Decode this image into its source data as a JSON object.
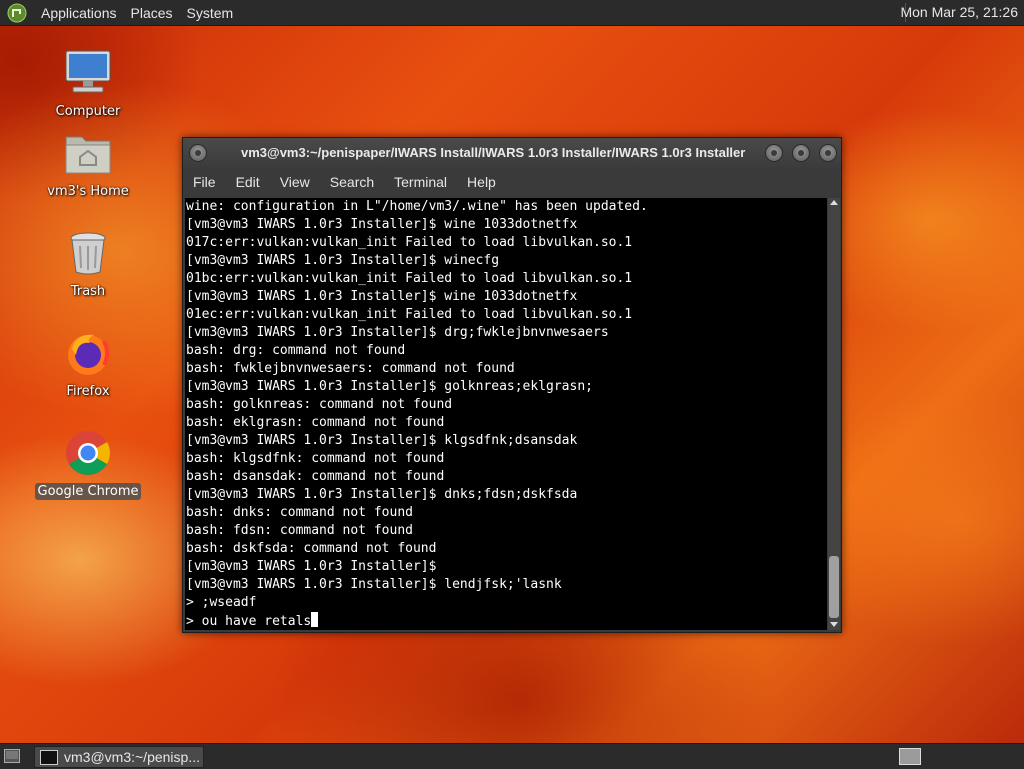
{
  "top_panel": {
    "menus": [
      "Applications",
      "Places",
      "System"
    ],
    "clock": "Mon Mar 25, 21:26"
  },
  "desktop_icons": [
    {
      "label": "Computer",
      "icon": "computer-icon"
    },
    {
      "label": "vm3's Home",
      "icon": "home-folder-icon"
    },
    {
      "label": "Trash",
      "icon": "trash-icon"
    },
    {
      "label": "Firefox",
      "icon": "firefox-icon"
    },
    {
      "label": "Google Chrome",
      "icon": "chrome-icon",
      "selected": true
    }
  ],
  "terminal": {
    "title": "vm3@vm3:~/penispaper/IWARS Install/IWARS 1.0r3 Installer/IWARS 1.0r3 Installer",
    "menus": [
      "File",
      "Edit",
      "View",
      "Search",
      "Terminal",
      "Help"
    ],
    "lines": [
      "wine: configuration in L\"/home/vm3/.wine\" has been updated.",
      "[vm3@vm3 IWARS 1.0r3 Installer]$ wine 1033dotnetfx",
      "017c:err:vulkan:vulkan_init Failed to load libvulkan.so.1",
      "[vm3@vm3 IWARS 1.0r3 Installer]$ winecfg",
      "01bc:err:vulkan:vulkan_init Failed to load libvulkan.so.1",
      "[vm3@vm3 IWARS 1.0r3 Installer]$ wine 1033dotnetfx",
      "01ec:err:vulkan:vulkan_init Failed to load libvulkan.so.1",
      "[vm3@vm3 IWARS 1.0r3 Installer]$ drg;fwklejbnvnwesaers",
      "bash: drg: command not found",
      "bash: fwklejbnvnwesaers: command not found",
      "[vm3@vm3 IWARS 1.0r3 Installer]$ golknreas;eklgrasn;",
      "bash: golknreas: command not found",
      "bash: eklgrasn: command not found",
      "[vm3@vm3 IWARS 1.0r3 Installer]$ klgsdfnk;dsansdak",
      "bash: klgsdfnk: command not found",
      "bash: dsansdak: command not found",
      "[vm3@vm3 IWARS 1.0r3 Installer]$ dnks;fdsn;dskfsda",
      "bash: dnks: command not found",
      "bash: fdsn: command not found",
      "bash: dskfsda: command not found",
      "[vm3@vm3 IWARS 1.0r3 Installer]$",
      "[vm3@vm3 IWARS 1.0r3 Installer]$ lendjfsk;'lasnk",
      "> ;wseadf",
      "> ou have retals"
    ]
  },
  "taskbar": {
    "task_label": "vm3@vm3:~/penisp..."
  }
}
